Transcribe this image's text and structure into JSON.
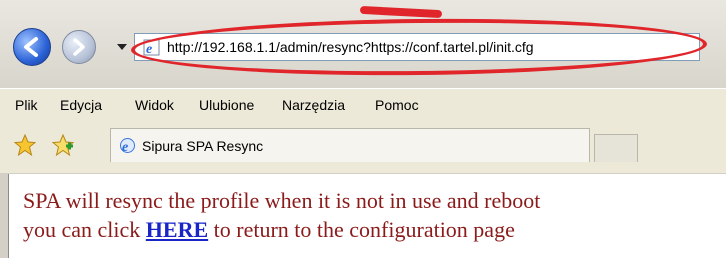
{
  "browser": {
    "address": "http://192.168.1.1/admin/resync?https://conf.tartel.pl/init.cfg",
    "menu": [
      "Plik",
      "Edycja",
      "Widok",
      "Ulubione",
      "Narzędzia",
      "Pomoc"
    ],
    "tab_title": "Sipura SPA Resync"
  },
  "page": {
    "line1": "SPA will resync the profile when it is not in use and reboot",
    "line2_before": "you can click ",
    "link_text": "HERE",
    "line2_after": " to return to the configuration page"
  },
  "colors": {
    "highlight": "#e0262b",
    "body_text": "#8b1a1a",
    "link": "#1a25c8"
  }
}
